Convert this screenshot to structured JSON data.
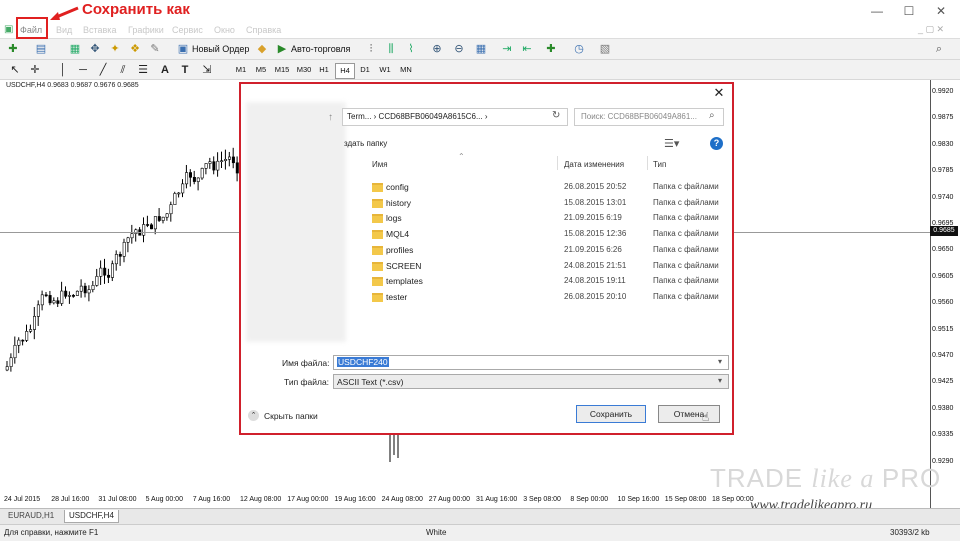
{
  "app": {
    "annotation": "Сохранить как"
  },
  "window_controls": {
    "minimize": "—",
    "maximize": "☐",
    "close": "✕"
  },
  "menu": [
    "Файл",
    "Вид",
    "Вставка",
    "Графики",
    "Сервис",
    "Окно",
    "Справка"
  ],
  "toolbar": {
    "new_order": "Новый Ордер",
    "auto_trading": "Авто-торговля",
    "timeframes": [
      "M1",
      "M5",
      "M15",
      "M30",
      "H1",
      "H4",
      "D1",
      "W1",
      "MN"
    ],
    "drawing_tools": [
      "A",
      "T"
    ]
  },
  "chart": {
    "symbol_info": "USDCHF,H4  0.9683 0.9687 0.9676 0.9685",
    "current_price": "0.9685",
    "price_labels": [
      "0.9920",
      "0.9875",
      "0.9830",
      "0.9785",
      "0.9740",
      "0.9695",
      "0.9650",
      "0.9605",
      "0.9560",
      "0.9515",
      "0.9470",
      "0.9425",
      "0.9380",
      "0.9335",
      "0.9290"
    ],
    "time_labels": [
      "24 Jul 2015",
      "28 Jul 16:00",
      "31 Jul 08:00",
      "5 Aug 00:00",
      "7 Aug 16:00",
      "12 Aug 08:00",
      "17 Aug 00:00",
      "19 Aug 16:00",
      "24 Aug 08:00",
      "27 Aug 00:00",
      "31 Aug 16:00",
      "3 Sep 08:00",
      "8 Sep 00:00",
      "10 Sep 16:00",
      "15 Sep 08:00",
      "18 Sep 00:00"
    ]
  },
  "chart_tabs": [
    "EURAUD,H1",
    "USDCHF,H4"
  ],
  "status": {
    "help": "Для справки, нажмите F1",
    "profile": "White",
    "traffic": "30393/2 kb"
  },
  "watermark": {
    "brand_a": "TRADE ",
    "brand_b": "like a ",
    "brand_c": "PRO",
    "url": "www.tradelikeapro.ru"
  },
  "dialog": {
    "close": "✕",
    "path": "Term... › CCD68BFB06049A8615C6... ›",
    "search_placeholder": "Поиск: CCD68BFB06049A861...",
    "new_folder": "здать папку",
    "columns": {
      "name": "Имя",
      "date": "Дата изменения",
      "type": "Тип"
    },
    "files": [
      {
        "name": "config",
        "date": "26.08.2015 20:52",
        "type": "Папка с файлами"
      },
      {
        "name": "history",
        "date": "15.08.2015 13:01",
        "type": "Папка с файлами"
      },
      {
        "name": "logs",
        "date": "21.09.2015 6:19",
        "type": "Папка с файлами"
      },
      {
        "name": "MQL4",
        "date": "15.08.2015 12:36",
        "type": "Папка с файлами"
      },
      {
        "name": "profiles",
        "date": "21.09.2015 6:26",
        "type": "Папка с файлами"
      },
      {
        "name": "SCREEN",
        "date": "24.08.2015 21:51",
        "type": "Папка с файлами"
      },
      {
        "name": "templates",
        "date": "24.08.2015 19:11",
        "type": "Папка с файлами"
      },
      {
        "name": "tester",
        "date": "26.08.2015 20:10",
        "type": "Папка с файлами"
      }
    ],
    "filename_label": "Имя файла:",
    "filename_value": "USDCHF240",
    "filetype_label": "Тип файла:",
    "filetype_value": "ASCII Text (*.csv)",
    "hide_folders": "Скрыть папки",
    "save": "Сохранить",
    "cancel": "Отмена"
  },
  "colors": {
    "annotation_red": "#e02020",
    "dialog_border": "#d0202c",
    "selection_blue": "#3a7bd5",
    "folder_yellow": "#f3c84a"
  }
}
